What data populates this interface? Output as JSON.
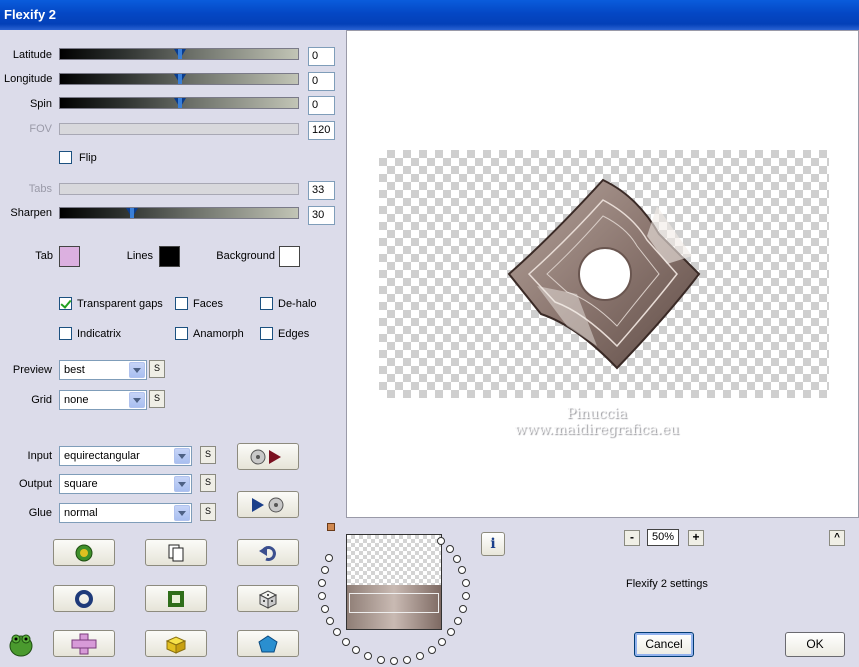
{
  "window": {
    "title": "Flexify 2"
  },
  "sliders": {
    "latitude": {
      "label": "Latitude",
      "value": "0"
    },
    "longitude": {
      "label": "Longitude",
      "value": "0"
    },
    "spin": {
      "label": "Spin",
      "value": "0"
    },
    "fov": {
      "label": "FOV",
      "value": "120"
    },
    "tabs": {
      "label": "Tabs",
      "value": "33"
    },
    "sharpen": {
      "label": "Sharpen",
      "value": "30"
    }
  },
  "flip": {
    "label": "Flip",
    "checked": false
  },
  "colors": {
    "tab": {
      "label": "Tab",
      "color": "#dcb0e0"
    },
    "lines": {
      "label": "Lines",
      "color": "#000000"
    },
    "background": {
      "label": "Background",
      "color": "#ffffff"
    }
  },
  "options": {
    "transparent_gaps": {
      "label": "Transparent gaps",
      "checked": true
    },
    "faces": {
      "label": "Faces",
      "checked": false
    },
    "de_halo": {
      "label": "De-halo",
      "checked": false
    },
    "indicatrix": {
      "label": "Indicatrix",
      "checked": false
    },
    "anamorph": {
      "label": "Anamorph",
      "checked": false
    },
    "edges": {
      "label": "Edges",
      "checked": false
    }
  },
  "preview_quality": {
    "label": "Preview",
    "value": "best"
  },
  "grid": {
    "label": "Grid",
    "value": "none"
  },
  "input": {
    "label": "Input",
    "value": "equirectangular"
  },
  "output": {
    "label": "Output",
    "value": "square"
  },
  "glue": {
    "label": "Glue",
    "value": "normal"
  },
  "s_button": "S",
  "watermark": {
    "line1": "Pinuccia",
    "line2": "www.maidiregrafica.eu"
  },
  "zoom": {
    "minus": "-",
    "value": "50%",
    "plus": "+",
    "up": "^"
  },
  "settings_label": "Flexify 2 settings",
  "info_label": "i",
  "buttons": {
    "cancel": "Cancel",
    "ok": "OK"
  }
}
